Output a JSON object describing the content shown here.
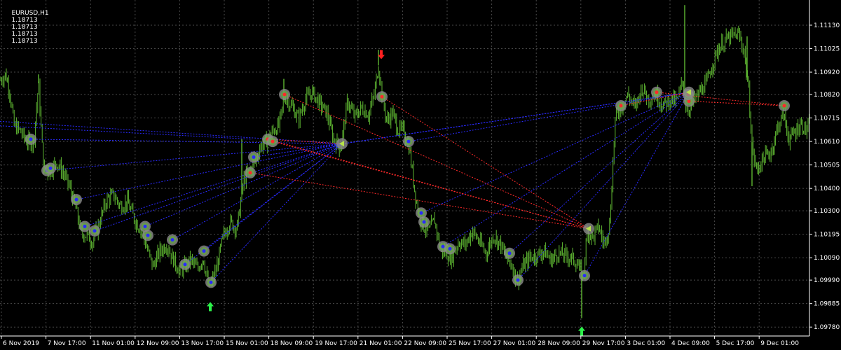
{
  "header": {
    "symbol": "EURUSD,H1",
    "ohlc": [
      "1.18713",
      "1.18713",
      "1.18713",
      "1.18713"
    ]
  },
  "colors": {
    "background": "#000000",
    "grid": "#4a4a4a",
    "candle": "#5fb832",
    "axis_text": "#ffffff",
    "buy_line": "#2a2aff",
    "sell_line": "#ff2a2a",
    "arrow_up": "#2cf24a",
    "arrow_down": "#ff2020",
    "marker_ring": "#8c8c8c"
  },
  "chart_data": {
    "type": "candlestick",
    "instrument": "EURUSD",
    "timeframe": "H1",
    "ylim": [
      1.0974,
      1.1118
    ],
    "y_ticks": [
      "1.11130",
      "1.11025",
      "1.10920",
      "1.10820",
      "1.10715",
      "1.10610",
      "1.10505",
      "1.10400",
      "1.10300",
      "1.10195",
      "1.10090",
      "1.09990",
      "1.09885",
      "1.09780"
    ],
    "x_ticks": [
      "6 Nov 2019",
      "7 Nov 17:00",
      "11 Nov 01:00",
      "12 Nov 09:00",
      "13 Nov 17:00",
      "15 Nov 01:00",
      "18 Nov 09:00",
      "19 Nov 17:00",
      "21 Nov 01:00",
      "22 Nov 09:00",
      "25 Nov 17:00",
      "27 Nov 01:00",
      "28 Nov 09:00",
      "29 Nov 17:00",
      "3 Dec 01:00",
      "4 Dec 09:00",
      "5 Dec 17:00",
      "9 Dec 01:00"
    ],
    "price_path": [
      [
        0,
        1.1088
      ],
      [
        8,
        1.1091
      ],
      [
        14,
        1.1083
      ],
      [
        20,
        1.1068
      ],
      [
        28,
        1.1066
      ],
      [
        38,
        1.1061
      ],
      [
        48,
        1.106
      ],
      [
        55,
        1.1087
      ],
      [
        62,
        1.1049
      ],
      [
        70,
        1.1047
      ],
      [
        80,
        1.1052
      ],
      [
        92,
        1.1046
      ],
      [
        100,
        1.104
      ],
      [
        108,
        1.1031
      ],
      [
        116,
        1.102
      ],
      [
        124,
        1.1019
      ],
      [
        132,
        1.1016
      ],
      [
        142,
        1.1025
      ],
      [
        152,
        1.1035
      ],
      [
        162,
        1.1037
      ],
      [
        172,
        1.1032
      ],
      [
        182,
        1.1034
      ],
      [
        192,
        1.1026
      ],
      [
        202,
        1.1021
      ],
      [
        210,
        1.1013
      ],
      [
        218,
        1.1005
      ],
      [
        228,
        1.1012
      ],
      [
        238,
        1.1015
      ],
      [
        246,
        1.1009
      ],
      [
        256,
        1.1003
      ],
      [
        264,
        1.1005
      ],
      [
        272,
        1.1008
      ],
      [
        282,
        1.1004
      ],
      [
        290,
        1.1009
      ],
      [
        298,
        1.0995
      ],
      [
        308,
        1.1003
      ],
      [
        318,
        1.1018
      ],
      [
        328,
        1.1025
      ],
      [
        338,
        1.1022
      ],
      [
        348,
        1.1044
      ],
      [
        356,
        1.1048
      ],
      [
        364,
        1.1052
      ],
      [
        372,
        1.1059
      ],
      [
        380,
        1.1061
      ],
      [
        390,
        1.1066
      ],
      [
        398,
        1.1068
      ],
      [
        406,
        1.1081
      ],
      [
        416,
        1.1077
      ],
      [
        426,
        1.1071
      ],
      [
        436,
        1.108
      ],
      [
        446,
        1.1083
      ],
      [
        456,
        1.1078
      ],
      [
        466,
        1.1074
      ],
      [
        476,
        1.1062
      ],
      [
        486,
        1.1058
      ],
      [
        496,
        1.1079
      ],
      [
        506,
        1.1072
      ],
      [
        516,
        1.1076
      ],
      [
        526,
        1.1073
      ],
      [
        534,
        1.1082
      ],
      [
        540,
        1.1095
      ],
      [
        546,
        1.108
      ],
      [
        552,
        1.107
      ],
      [
        560,
        1.1074
      ],
      [
        568,
        1.1066
      ],
      [
        576,
        1.1066
      ],
      [
        584,
        1.1058
      ],
      [
        592,
        1.1038
      ],
      [
        598,
        1.1028
      ],
      [
        604,
        1.1023
      ],
      [
        612,
        1.1021
      ],
      [
        620,
        1.1026
      ],
      [
        628,
        1.1013
      ],
      [
        636,
        1.1011
      ],
      [
        644,
        1.1009
      ],
      [
        654,
        1.1016
      ],
      [
        664,
        1.1015
      ],
      [
        674,
        1.1021
      ],
      [
        684,
        1.1016
      ],
      [
        694,
        1.1011
      ],
      [
        704,
        1.1019
      ],
      [
        714,
        1.1015
      ],
      [
        722,
        1.1009
      ],
      [
        730,
        1.1006
      ],
      [
        738,
        1.0998
      ],
      [
        746,
        1.1005
      ],
      [
        756,
        1.1009
      ],
      [
        766,
        1.101
      ],
      [
        776,
        1.1012
      ],
      [
        786,
        1.1008
      ],
      [
        796,
        1.1011
      ],
      [
        806,
        1.101
      ],
      [
        816,
        1.1009
      ],
      [
        824,
        1.1006
      ],
      [
        832,
        1.1
      ],
      [
        838,
        1.1021
      ],
      [
        846,
        1.1018
      ],
      [
        854,
        1.1023
      ],
      [
        862,
        1.1015
      ],
      [
        870,
        1.1024
      ],
      [
        878,
        1.1072
      ],
      [
        886,
        1.1076
      ],
      [
        896,
        1.1082
      ],
      [
        906,
        1.1076
      ],
      [
        916,
        1.1085
      ],
      [
        926,
        1.108
      ],
      [
        936,
        1.1082
      ],
      [
        946,
        1.1077
      ],
      [
        956,
        1.108
      ],
      [
        966,
        1.1079
      ],
      [
        974,
        1.1088
      ],
      [
        980,
        1.1075
      ],
      [
        988,
        1.1078
      ],
      [
        998,
        1.1083
      ],
      [
        1008,
        1.1087
      ],
      [
        1016,
        1.1095
      ],
      [
        1024,
        1.1102
      ],
      [
        1034,
        1.1106
      ],
      [
        1044,
        1.1108
      ],
      [
        1054,
        1.1109
      ],
      [
        1062,
        1.1101
      ],
      [
        1068,
        1.1084
      ],
      [
        1074,
        1.1056
      ],
      [
        1080,
        1.1048
      ],
      [
        1090,
        1.1054
      ],
      [
        1100,
        1.1056
      ],
      [
        1110,
        1.1068
      ],
      [
        1118,
        1.1073
      ],
      [
        1126,
        1.1062
      ],
      [
        1134,
        1.1065
      ],
      [
        1142,
        1.1069
      ],
      [
        1150,
        1.1066
      ],
      [
        1155,
        1.1068
      ]
    ],
    "spikes": [
      [
        55,
        1.1091
      ],
      [
        345,
        1.1062
      ],
      [
        405,
        1.1089
      ],
      [
        540,
        1.1102
      ],
      [
        830,
        1.0982
      ],
      [
        977,
        1.1122
      ],
      [
        1066,
        1.1108
      ],
      [
        1073,
        1.1041
      ]
    ],
    "buy_markers": [
      [
        44,
        1.1062
      ],
      [
        67,
        1.1048
      ],
      [
        72,
        1.1049
      ],
      [
        109,
        1.1035
      ],
      [
        121,
        1.1023
      ],
      [
        135,
        1.1021
      ],
      [
        207,
        1.1023
      ],
      [
        211,
        1.1019
      ],
      [
        246,
        1.1017
      ],
      [
        264,
        1.1006
      ],
      [
        291,
        1.1012
      ],
      [
        301,
        1.0998
      ],
      [
        362,
        1.1054
      ],
      [
        583,
        1.1061
      ],
      [
        601,
        1.1029
      ],
      [
        605,
        1.1025
      ],
      [
        632,
        1.1014
      ],
      [
        642,
        1.1013
      ],
      [
        727,
        1.1011
      ],
      [
        739,
        1.0999
      ],
      [
        834,
        1.1001
      ]
    ],
    "sell_markers": [
      [
        357,
        1.1047
      ],
      [
        382,
        1.1062
      ],
      [
        389,
        1.1061
      ],
      [
        406,
        1.1082
      ],
      [
        545,
        1.1081
      ],
      [
        886,
        1.1077
      ],
      [
        937,
        1.1083
      ],
      [
        983,
        1.1079
      ],
      [
        982,
        1.1082
      ],
      [
        1119,
        1.1077
      ]
    ],
    "close_markers": [
      [
        488,
        1.106
      ],
      [
        840,
        1.1022
      ],
      [
        983,
        1.1083
      ]
    ],
    "buy_links": [
      [
        [
          44,
          1.1062
        ],
        [
          488,
          1.106
        ]
      ],
      [
        [
          67,
          1.1048
        ],
        [
          488,
          1.106
        ]
      ],
      [
        [
          109,
          1.1035
        ],
        [
          488,
          1.106
        ]
      ],
      [
        [
          121,
          1.1023
        ],
        [
          488,
          1.106
        ]
      ],
      [
        [
          135,
          1.1021
        ],
        [
          488,
          1.106
        ]
      ],
      [
        [
          207,
          1.1023
        ],
        [
          488,
          1.106
        ]
      ],
      [
        [
          246,
          1.1017
        ],
        [
          488,
          1.106
        ]
      ],
      [
        [
          291,
          1.1012
        ],
        [
          488,
          1.106
        ]
      ],
      [
        [
          301,
          1.0998
        ],
        [
          488,
          1.106
        ]
      ],
      [
        [
          0,
          1.107
        ],
        [
          488,
          1.106
        ]
      ],
      [
        [
          362,
          1.1054
        ],
        [
          488,
          1.106
        ]
      ],
      [
        [
          583,
          1.1061
        ],
        [
          983,
          1.1083
        ]
      ],
      [
        [
          601,
          1.1029
        ],
        [
          983,
          1.1083
        ]
      ],
      [
        [
          632,
          1.1014
        ],
        [
          983,
          1.1083
        ]
      ],
      [
        [
          727,
          1.1011
        ],
        [
          983,
          1.1083
        ]
      ],
      [
        [
          739,
          1.0999
        ],
        [
          983,
          1.1083
        ]
      ],
      [
        [
          834,
          1.1001
        ],
        [
          983,
          1.1083
        ]
      ],
      [
        [
          488,
          1.106
        ],
        [
          983,
          1.1083
        ]
      ],
      [
        [
          362,
          1.1054
        ],
        [
          983,
          1.1083
        ]
      ],
      [
        [
          264,
          1.1006
        ],
        [
          488,
          1.106
        ]
      ],
      [
        [
          0,
          1.1068
        ],
        [
          360,
          1.1062
        ]
      ]
    ],
    "sell_links": [
      [
        [
          357,
          1.1047
        ],
        [
          840,
          1.1022
        ]
      ],
      [
        [
          382,
          1.1062
        ],
        [
          840,
          1.1022
        ]
      ],
      [
        [
          389,
          1.1061
        ],
        [
          840,
          1.1022
        ]
      ],
      [
        [
          406,
          1.1082
        ],
        [
          840,
          1.1022
        ]
      ],
      [
        [
          545,
          1.1081
        ],
        [
          840,
          1.1022
        ]
      ],
      [
        [
          937,
          1.1083
        ],
        [
          1119,
          1.1077
        ]
      ],
      [
        [
          983,
          1.1079
        ],
        [
          1119,
          1.1077
        ]
      ],
      [
        [
          886,
          1.1077
        ],
        [
          983,
          1.1083
        ]
      ],
      [
        [
          382,
          1.1062
        ],
        [
          488,
          1.106
        ]
      ]
    ],
    "arrows_up": [
      [
        300,
        1.0987
      ],
      [
        830,
        1.0976
      ]
    ],
    "arrows_down": [
      [
        544,
        1.11
      ]
    ]
  }
}
